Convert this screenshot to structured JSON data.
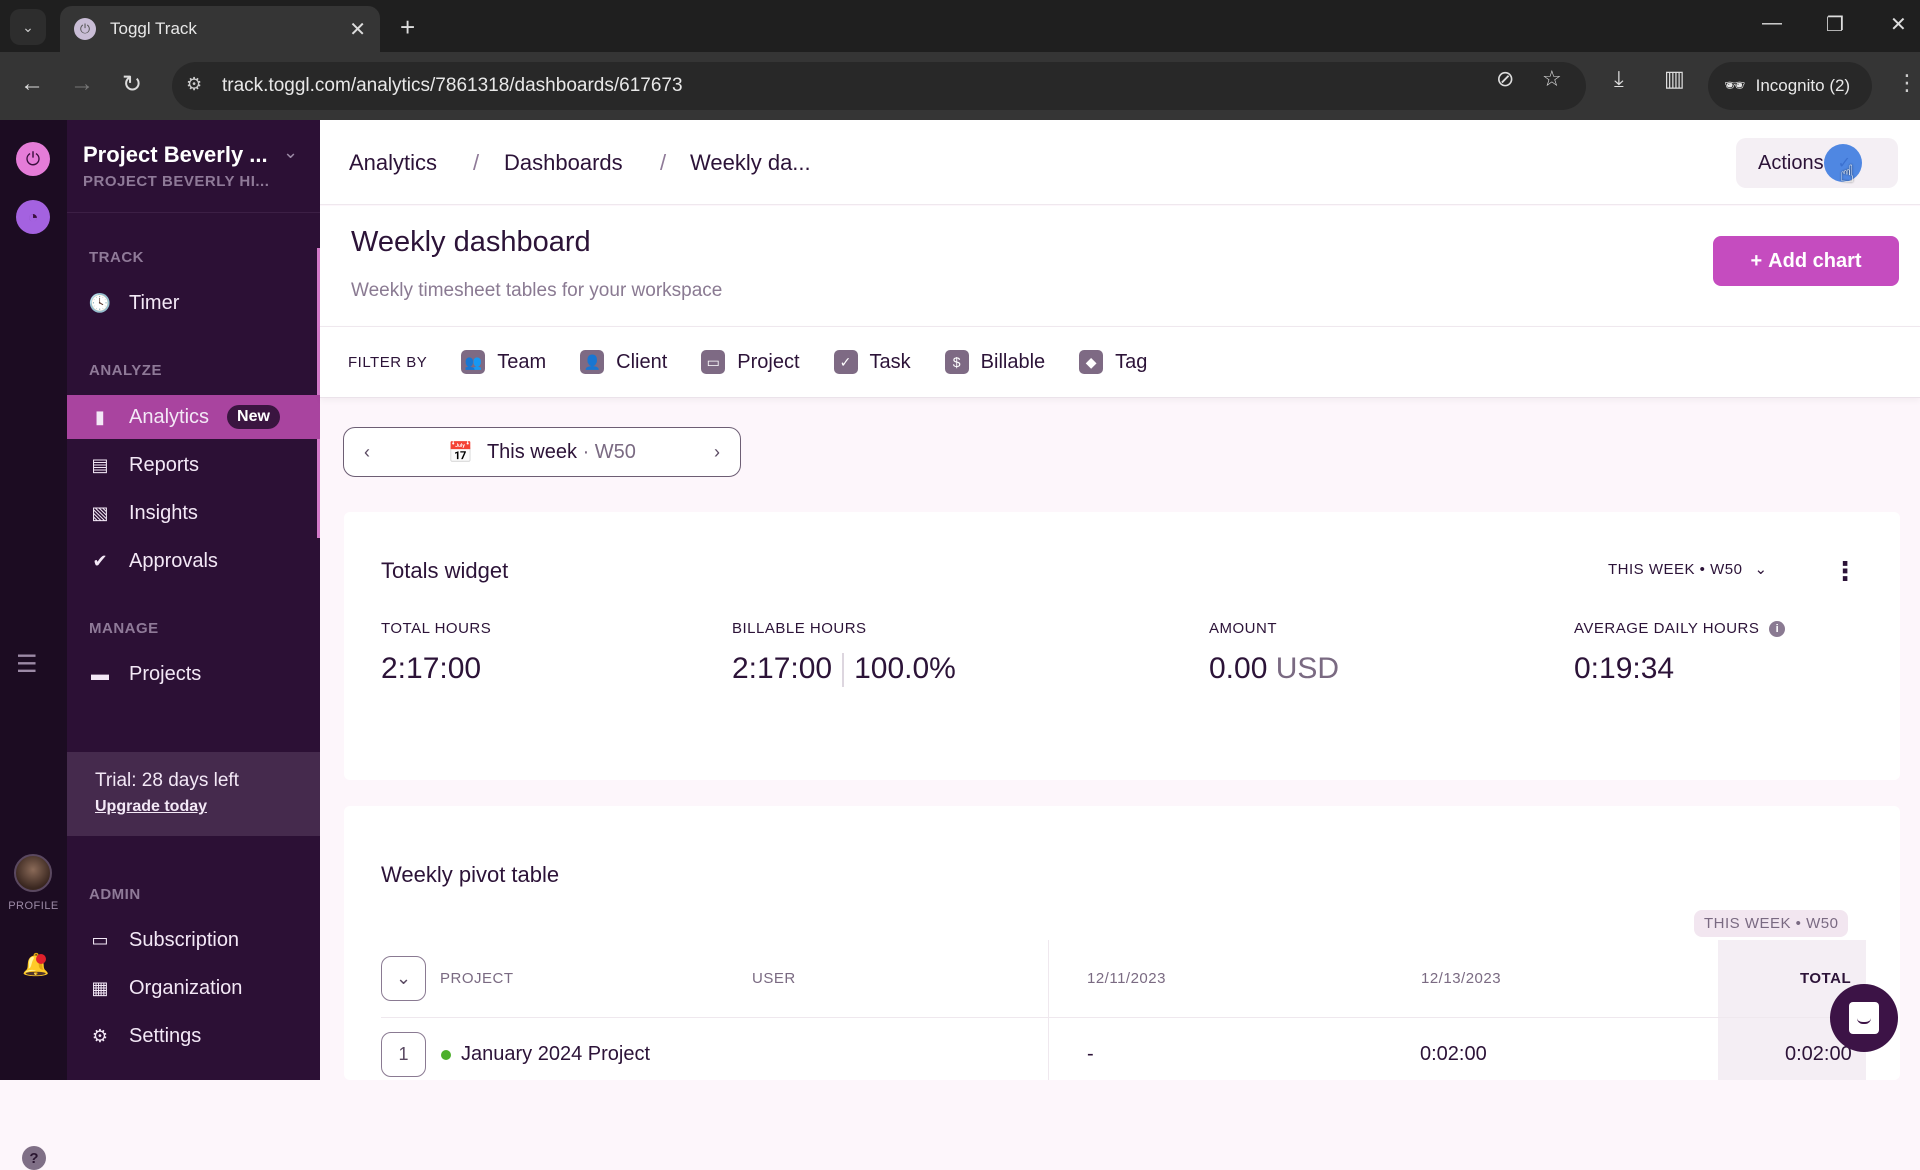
{
  "browser": {
    "tab_title": "Toggl Track",
    "url": "track.toggl.com/analytics/7861318/dashboards/617673",
    "incognito_label": "Incognito (2)"
  },
  "strip": {
    "profile_label": "PROFILE"
  },
  "sidebar": {
    "workspace_title": "Project Beverly ...",
    "workspace_subtitle": "PROJECT BEVERLY HI...",
    "sections": {
      "track": "TRACK",
      "analyze": "ANALYZE",
      "manage": "MANAGE",
      "admin": "ADMIN"
    },
    "items": [
      {
        "label": "Timer",
        "icon": "clock-icon"
      },
      {
        "label": "Analytics",
        "icon": "bar-chart-icon",
        "badge": "New",
        "active": true
      },
      {
        "label": "Reports",
        "icon": "report-icon"
      },
      {
        "label": "Insights",
        "icon": "insights-icon"
      },
      {
        "label": "Approvals",
        "icon": "check-circle-icon"
      },
      {
        "label": "Projects",
        "icon": "folder-icon"
      },
      {
        "label": "Subscription",
        "icon": "credit-card-icon"
      },
      {
        "label": "Organization",
        "icon": "building-icon"
      },
      {
        "label": "Settings",
        "icon": "gear-icon"
      }
    ],
    "trial": {
      "text": "Trial: 28 days left",
      "link": "Upgrade today"
    },
    "accent_color": "#a9449f"
  },
  "topbar": {
    "breadcrumb": [
      "Analytics",
      "Dashboards",
      "Weekly da..."
    ],
    "actions_label": "Actions"
  },
  "header": {
    "title": "Weekly dashboard",
    "subtitle": "Weekly timesheet tables for your workspace",
    "add_chart_label": "Add chart",
    "add_chart_color": "#c54cbf"
  },
  "filters": {
    "label": "FILTER BY",
    "items": [
      "Team",
      "Client",
      "Project",
      "Task",
      "Billable",
      "Tag"
    ]
  },
  "week_picker": {
    "label": "This week",
    "week": "W50"
  },
  "totals_widget": {
    "title": "Totals widget",
    "period": "THIS WEEK • W50",
    "stats": {
      "total_hours": {
        "label": "TOTAL HOURS",
        "value": "2:17:00"
      },
      "billable_hours": {
        "label": "BILLABLE HOURS",
        "value": "2:17:00",
        "percent": "100.0%"
      },
      "amount": {
        "label": "AMOUNT",
        "value": "0.00",
        "unit": "USD"
      },
      "average_daily": {
        "label": "AVERAGE DAILY HOURS",
        "value": "0:19:34"
      }
    }
  },
  "pivot": {
    "title": "Weekly pivot table",
    "period_tag": "THIS WEEK • W50",
    "columns": [
      "PROJECT",
      "USER",
      "12/11/2023",
      "12/13/2023",
      "TOTAL"
    ],
    "rows": [
      {
        "index": "1",
        "project": "January 2024 Project",
        "project_color": "#4caf2a",
        "user": "",
        "d1": "-",
        "d2": "0:02:00",
        "total": "0:02:00"
      }
    ]
  }
}
